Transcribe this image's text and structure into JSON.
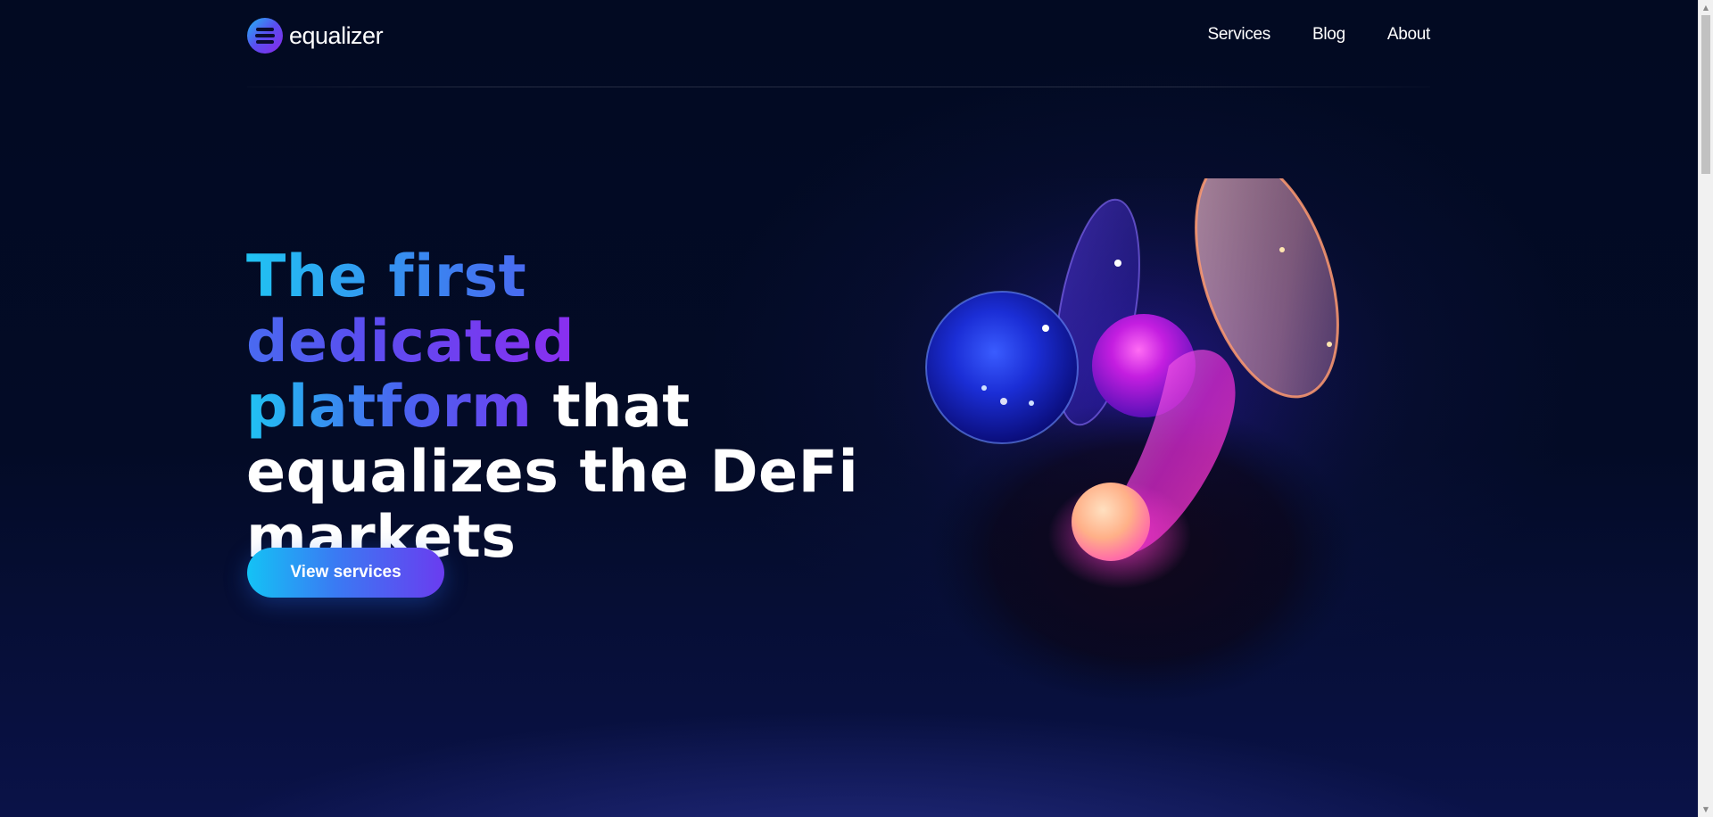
{
  "brand": {
    "name": "equalizer"
  },
  "nav": {
    "items": [
      {
        "label": "Services"
      },
      {
        "label": "Blog"
      },
      {
        "label": "About"
      }
    ]
  },
  "hero": {
    "headline_gradient": "The first dedicated",
    "headline_gradient_2": "platform",
    "headline_rest_1": " that",
    "headline_rest_2": "equalizes the DeFi",
    "headline_rest_3": "markets",
    "cta_label": "View services"
  },
  "colors": {
    "background": "#030a24",
    "accent_cyan": "#20c3f2",
    "accent_blue": "#4a63f0",
    "accent_purple": "#8a2ef0",
    "text": "#ffffff"
  },
  "icons": {
    "logo": "equalizer-logo-icon",
    "scroll_up": "scroll-up-arrow-icon",
    "scroll_down": "scroll-down-arrow-icon"
  }
}
